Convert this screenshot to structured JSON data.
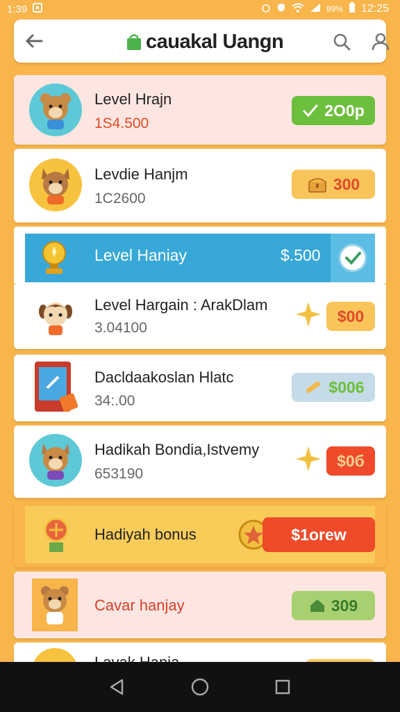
{
  "status": {
    "time_left": "1:39",
    "battery": "99%",
    "time_right": "12:25"
  },
  "header": {
    "title": "cauakal Uangn"
  },
  "items": [
    {
      "title": "Level Hrajn",
      "value": "1S4.500",
      "reward": "2О0р"
    },
    {
      "title": "Levdie Hanjm",
      "value": "1C2600",
      "reward": "300"
    },
    {
      "title": "Level Haniay",
      "reward": "$.500"
    },
    {
      "title": "Level Hargain : ArakDlam",
      "value": "3.04100",
      "reward": "$00"
    },
    {
      "title": "Dacldaakoslan Hlatc",
      "value": "34:.00",
      "reward": "$006"
    },
    {
      "title": "Hadikah Bondia,Istvemy",
      "value": "653190",
      "reward": "$0б"
    },
    {
      "title": "Hadiyah bonus",
      "reward": "$1orew"
    },
    {
      "title": "Cavar hanjay",
      "reward": "309"
    },
    {
      "title": "Lavak Hanja"
    }
  ],
  "colors": {
    "background": "#f7b54b",
    "green": "#6cbf3c",
    "orange_pill": "#f9c45a",
    "blue_banner": "#38a8d8",
    "red": "#ef4a2a",
    "pink_card": "#fde6e1"
  }
}
